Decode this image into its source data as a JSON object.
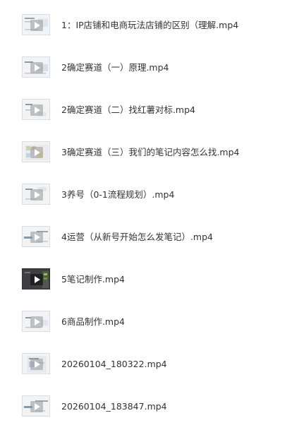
{
  "files": [
    {
      "name": "1：IP店铺和电商玩法店铺的区别（理解.mp4",
      "thumb_style": "light",
      "icon": "video-file-icon"
    },
    {
      "name": "2确定赛道（一）原理.mp4",
      "thumb_style": "light",
      "icon": "video-file-icon"
    },
    {
      "name": "2确定赛道（二）找红薯对标.mp4",
      "thumb_style": "light",
      "icon": "video-file-icon"
    },
    {
      "name": "3确定赛道（三）我们的笔记内容怎么找.mp4",
      "thumb_style": "light",
      "icon": "video-file-icon"
    },
    {
      "name": "3养号（0-1流程规划）.mp4",
      "thumb_style": "light",
      "icon": "video-file-icon"
    },
    {
      "name": "4运营（从新号开始怎么发笔记）.mp4",
      "thumb_style": "light",
      "icon": "video-file-icon"
    },
    {
      "name": "5笔记制作.mp4",
      "thumb_style": "dark",
      "icon": "video-file-icon"
    },
    {
      "name": "6商品制作.mp4",
      "thumb_style": "light",
      "icon": "video-file-icon"
    },
    {
      "name": "20260104_180322.mp4",
      "thumb_style": "light",
      "icon": "video-file-icon"
    },
    {
      "name": "20260104_183847.mp4",
      "thumb_style": "light",
      "icon": "video-file-icon"
    }
  ]
}
